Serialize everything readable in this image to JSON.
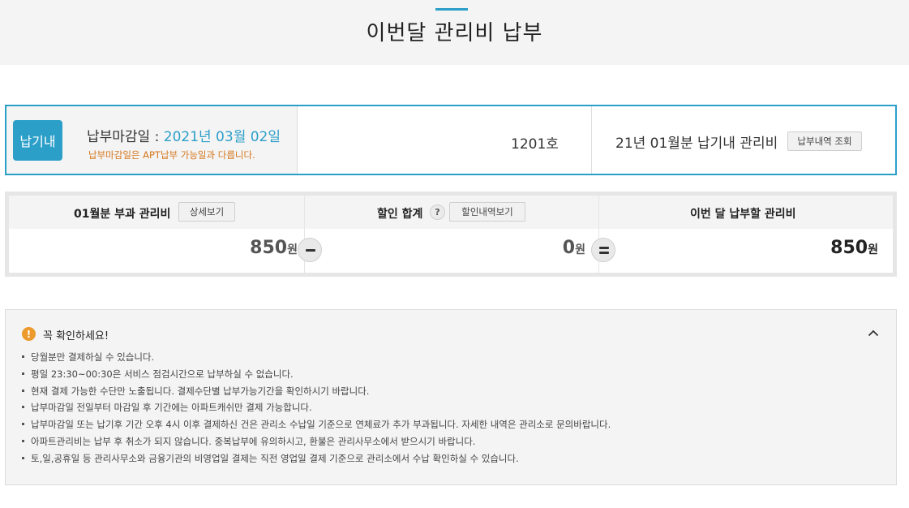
{
  "header": {
    "title": "이번달 관리비 납부"
  },
  "info": {
    "badge": "납기내",
    "due_label": "납부마감일 : ",
    "due_date": "2021년 03월 02일",
    "due_note": "납부마감일은 APT납부 가능일과 다릅니다.",
    "unit": "1201호",
    "month_label": "21년 01월분 납기내 관리비",
    "history_button": "납부내역 조회"
  },
  "calc": {
    "charged": {
      "label": "01월분 부과 관리비",
      "button": "상세보기",
      "amount": "850",
      "currency": "원"
    },
    "discount": {
      "label": "할인 합계",
      "help": "?",
      "button": "할인내역보기",
      "amount": "0",
      "currency": "원"
    },
    "total": {
      "label": "이번 달 납부할 관리비",
      "amount": "850",
      "currency": "원"
    }
  },
  "notice": {
    "icon": "!",
    "title": "꼭 확인하세요!",
    "items": [
      "당월분만 결제하실 수 있습니다.",
      "평일 23:30~00:30은 서비스 점검시간으로 납부하실 수 없습니다.",
      "현재 결제 가능한 수단만 노출됩니다. 결제수단별 납부가능기간을 확인하시기 바랍니다.",
      "납부마감일 전일부터 마감일 후 기간에는 아파트캐쉬만 결제 가능합니다.",
      "납부마감일 또는 납기후 기간 오후 4시 이후 결제하신 건은 관리소 수납일 기준으로 연체료가 추가 부과됩니다. 자세한 내역은 관리소로 문의바랍니다.",
      "아파트관리비는 납부 후 취소가 되지 않습니다. 중복납부에 유의하시고, 환불은 관리사무소에서 받으시기 바랍니다.",
      "토,일,공휴일 등 관리사무소와 금융기관의 비영업일 결제는 직전 영업일 결제 기준으로 관리소에서 수납 확인하실 수 있습니다."
    ]
  },
  "colors": {
    "accent": "#2c9fc9",
    "warning": "#ec9a2b",
    "note": "#d5761c"
  }
}
